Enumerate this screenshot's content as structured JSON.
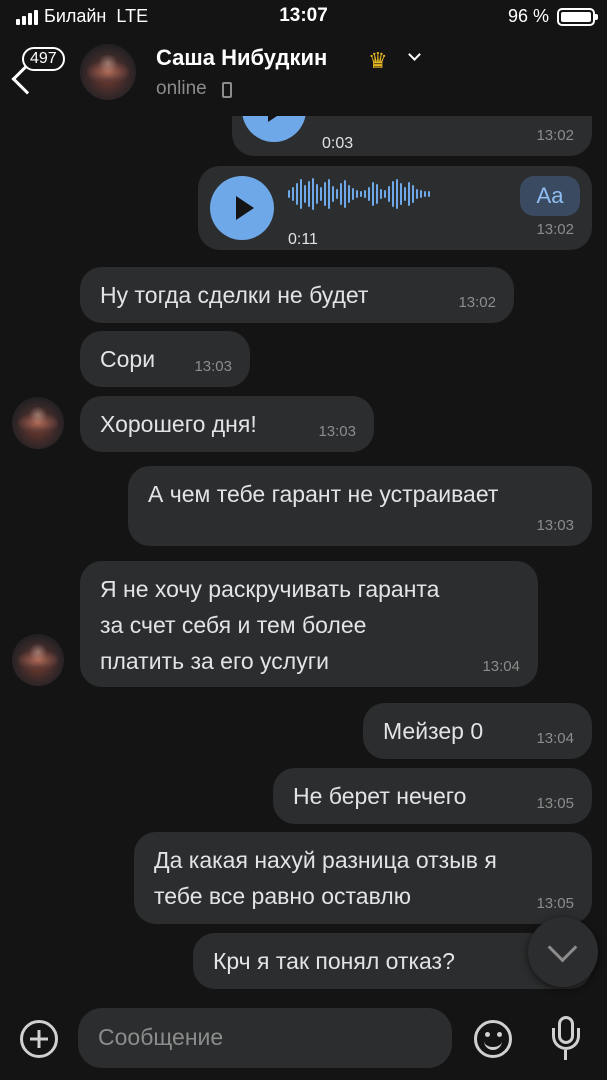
{
  "status_bar": {
    "carrier": "Билайн",
    "network": "LTE",
    "time": "13:07",
    "battery": "96 %"
  },
  "header": {
    "unread_count": "497",
    "contact_name": "Саша Нибудкин",
    "status": "online"
  },
  "messages": [
    {
      "type": "voice",
      "direction": "out",
      "duration": "0:03",
      "time": "13:02"
    },
    {
      "type": "voice",
      "direction": "out",
      "duration": "0:11",
      "time": "13:02",
      "transcribe_label": "Aa"
    },
    {
      "type": "text",
      "direction": "in",
      "text": "Ну тогда сделки не будет",
      "time": "13:02"
    },
    {
      "type": "text",
      "direction": "in",
      "text": "Сори",
      "time": "13:03"
    },
    {
      "type": "text",
      "direction": "in",
      "text": "Хорошего дня!",
      "time": "13:03"
    },
    {
      "type": "text",
      "direction": "out",
      "text": "А чем тебе гарант не устраивает",
      "time": "13:03"
    },
    {
      "type": "text",
      "direction": "in",
      "lines": [
        "Я не хочу раскручивать гаранта",
        "за счет себя и тем более",
        "платить за его услуги"
      ],
      "time": "13:04"
    },
    {
      "type": "text",
      "direction": "out",
      "text": "Мейзер 0",
      "time": "13:04"
    },
    {
      "type": "text",
      "direction": "out",
      "text": "Не берет нечего",
      "time": "13:05"
    },
    {
      "type": "text",
      "direction": "out",
      "lines": [
        "Да какая нахуй разница отзыв я",
        "тебе все равно оставлю"
      ],
      "time": "13:05"
    },
    {
      "type": "text",
      "direction": "out",
      "text": "Крч я так понял отказ?",
      "time": ""
    }
  ],
  "composer": {
    "placeholder": "Сообщение"
  },
  "icons": [
    "back-icon",
    "crown-icon",
    "chevron-down-icon",
    "phone-icon",
    "play-icon",
    "plus-icon",
    "emoji-icon",
    "microphone-icon",
    "scroll-down-icon"
  ],
  "colors": {
    "background": "#141414",
    "bubble": "#2c2d2e",
    "accent": "#6fa8e8",
    "muted": "#8c8c8c"
  }
}
